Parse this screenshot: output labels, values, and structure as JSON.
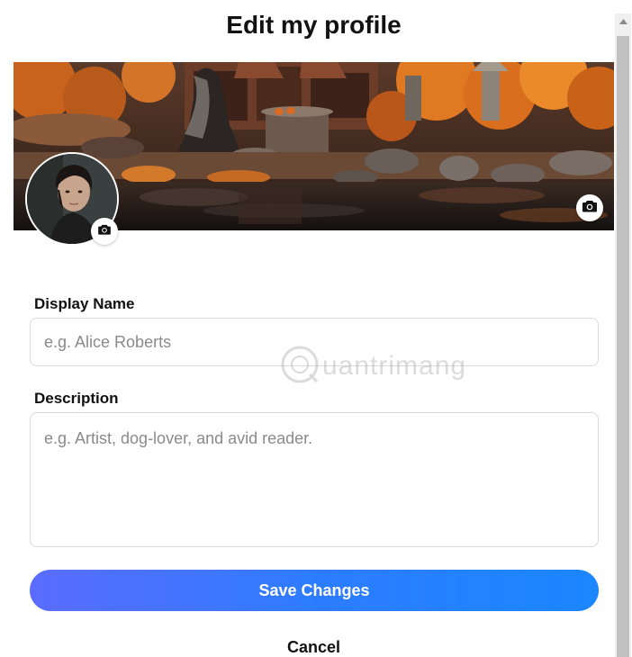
{
  "header": {
    "title": "Edit my profile"
  },
  "profile": {
    "cover_camera_icon": "camera-icon",
    "avatar_camera_icon": "camera-icon"
  },
  "form": {
    "display_name": {
      "label": "Display Name",
      "placeholder": "e.g. Alice Roberts",
      "value": ""
    },
    "description": {
      "label": "Description",
      "placeholder": "e.g. Artist, dog-lover, and avid reader.",
      "value": ""
    }
  },
  "actions": {
    "save_label": "Save Changes",
    "cancel_label": "Cancel"
  },
  "watermark": {
    "text": "uantrimang"
  },
  "colors": {
    "accent_start": "#5b6cff",
    "accent_end": "#1a86ff",
    "text": "#111111",
    "border": "#d9d9d9"
  }
}
